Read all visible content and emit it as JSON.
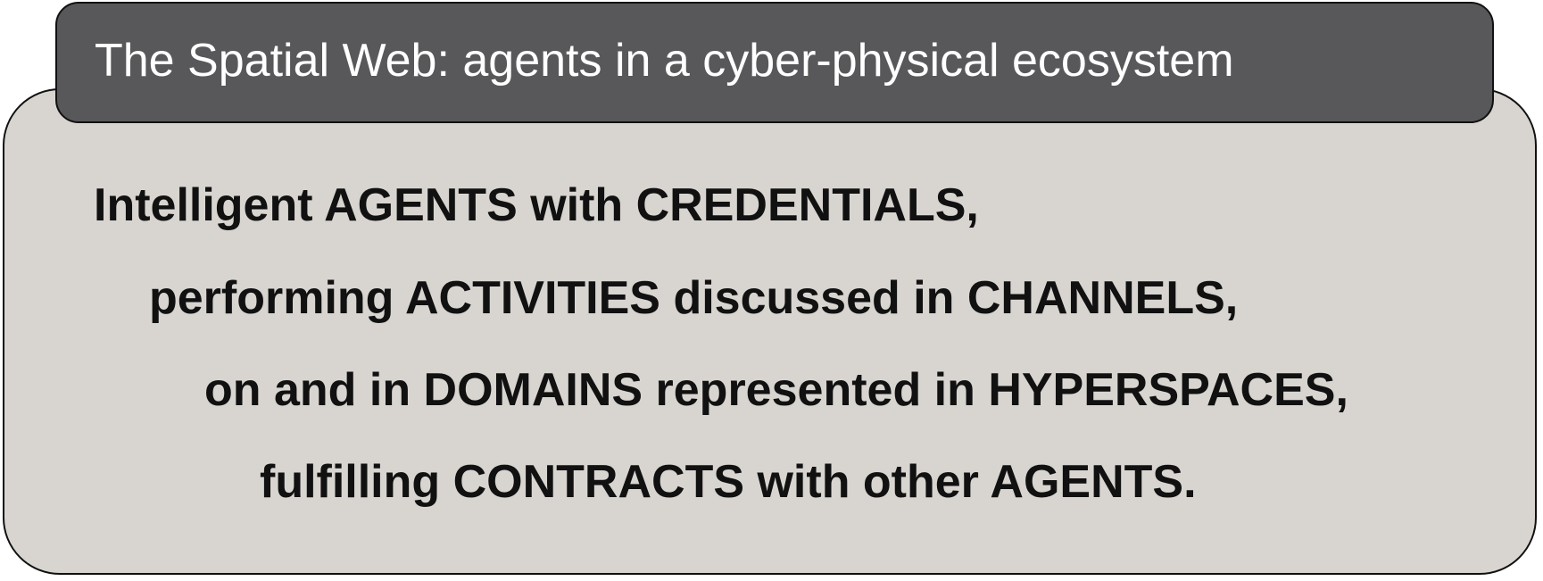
{
  "title": "The Spatial Web: agents in a cyber-physical ecosystem",
  "lines": [
    "Intelligent AGENTS with CREDENTIALS,",
    "performing ACTIVITIES discussed in CHANNELS,",
    "on and in DOMAINS represented in HYPERSPACES,",
    "fulfilling CONTRACTS with other AGENTS."
  ],
  "colors": {
    "title_bar": "#58585a",
    "panel": "#d8d5d1",
    "border": "#111111",
    "title_text": "#ffffff",
    "body_text": "#111111"
  }
}
